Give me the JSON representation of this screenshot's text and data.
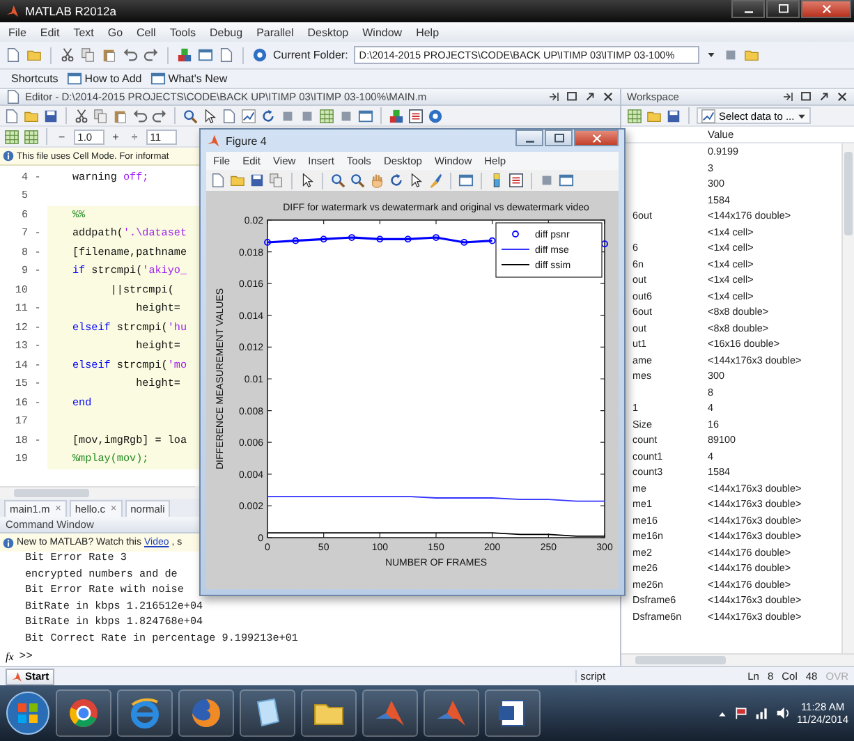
{
  "window": {
    "title": "MATLAB  R2012a"
  },
  "menu": [
    "File",
    "Edit",
    "Text",
    "Go",
    "Cell",
    "Tools",
    "Debug",
    "Parallel",
    "Desktop",
    "Window",
    "Help"
  ],
  "toolbar": {
    "folder_label": "Current Folder:",
    "folder_path": "D:\\2014-2015 PROJECTS\\CODE\\BACK UP\\ITIMP 03\\ITIMP 03-100%"
  },
  "shortcuts": [
    {
      "label": "Shortcuts",
      "kind": "plain"
    },
    {
      "label": "How to Add",
      "kind": "link"
    },
    {
      "label": "What's New",
      "kind": "link"
    }
  ],
  "editor": {
    "title": "Editor - D:\\2014-2015 PROJECTS\\CODE\\BACK UP\\ITIMP 03\\ITIMP 03-100%\\MAIN.m",
    "zoom": {
      "minus": "−",
      "value": "1.0",
      "plus": "+",
      "divide": "÷",
      "cell": "11"
    },
    "info": "This file uses Cell Mode. For informat",
    "lines": [
      {
        "num": "4",
        "marker": "-",
        "in_cell": false,
        "tokens": [
          {
            "kind": "plain",
            "text": "warning "
          },
          {
            "kind": "string",
            "text": "off;"
          }
        ]
      },
      {
        "num": "5",
        "in_cell": false
      },
      {
        "num": "6",
        "in_cell": true,
        "tokens": [
          {
            "kind": "comment",
            "text": "%%"
          }
        ]
      },
      {
        "num": "7",
        "marker": "-",
        "in_cell": true,
        "tokens": [
          {
            "kind": "plain",
            "text": "addpath("
          },
          {
            "kind": "string",
            "text": "'.\\dataset"
          }
        ]
      },
      {
        "num": "8",
        "marker": "-",
        "in_cell": true,
        "tokens": [
          {
            "kind": "plain",
            "text": "[filename,pathname"
          }
        ]
      },
      {
        "num": "9",
        "marker": "-",
        "in_cell": true,
        "tokens": [
          {
            "kind": "keyword",
            "text": "if"
          },
          {
            "kind": "plain",
            "text": " strcmpi("
          },
          {
            "kind": "string",
            "text": "'akiyo_"
          }
        ]
      },
      {
        "num": "10",
        "in_cell": true,
        "tokens": [
          {
            "kind": "plain",
            "text": "      ||strcmpi("
          }
        ]
      },
      {
        "num": "11",
        "marker": "-",
        "in_cell": true,
        "tokens": [
          {
            "kind": "plain",
            "text": "          height="
          }
        ]
      },
      {
        "num": "12",
        "marker": "-",
        "in_cell": true,
        "tokens": [
          {
            "kind": "keyword",
            "text": "elseif"
          },
          {
            "kind": "plain",
            "text": " strcmpi("
          },
          {
            "kind": "string",
            "text": "'hu"
          }
        ]
      },
      {
        "num": "13",
        "marker": "-",
        "in_cell": true,
        "tokens": [
          {
            "kind": "plain",
            "text": "          height="
          }
        ]
      },
      {
        "num": "14",
        "marker": "-",
        "in_cell": true,
        "tokens": [
          {
            "kind": "keyword",
            "text": "elseif"
          },
          {
            "kind": "plain",
            "text": " strcmpi("
          },
          {
            "kind": "string",
            "text": "'mo"
          }
        ]
      },
      {
        "num": "15",
        "marker": "-",
        "in_cell": true,
        "tokens": [
          {
            "kind": "plain",
            "text": "          height="
          }
        ]
      },
      {
        "num": "16",
        "marker": "-",
        "in_cell": true,
        "tokens": [
          {
            "kind": "keyword",
            "text": "end"
          }
        ]
      },
      {
        "num": "17",
        "in_cell": true
      },
      {
        "num": "18",
        "marker": "-",
        "in_cell": true,
        "tokens": [
          {
            "kind": "plain",
            "text": "[mov,imgRgb] = loa"
          }
        ]
      },
      {
        "num": "19",
        "in_cell": true,
        "tokens": [
          {
            "kind": "comment",
            "text": "%mplay(mov);"
          }
        ]
      }
    ],
    "tabs": [
      {
        "label": "main1.m",
        "close": "×"
      },
      {
        "label": "hello.c",
        "close": "×"
      },
      {
        "label": "normali"
      }
    ]
  },
  "command": {
    "title": "Command Window",
    "info": {
      "text": "New to MATLAB? Watch this",
      "link": "Video",
      "tail": ", s"
    },
    "output": [
      "Bit Error Rate 3",
      "encrypted numbers and de",
      "Bit Error Rate with noise",
      "BitRate in kbps 1.216512e+04",
      "BitRate in kbps 1.824768e+04",
      "Bit Correct Rate in percentage 9.199213e+01"
    ],
    "prompt": {
      "fx": "fx",
      "symbol": ">>"
    }
  },
  "workspace": {
    "title": "Workspace",
    "select_button": "Select data to ...",
    "value_header": "Value",
    "rows": [
      {
        "value": "0.9199"
      },
      {
        "value": "3"
      },
      {
        "value": "300"
      },
      {
        "value": "1584"
      },
      {
        "name": "6out",
        "value": "<144x176 double>"
      },
      {
        "value": "<1x4 cell>"
      },
      {
        "name": "6",
        "value": "<1x4 cell>"
      },
      {
        "name": "6n",
        "value": "<1x4 cell>"
      },
      {
        "name": "out",
        "value": "<1x4 cell>"
      },
      {
        "name": "out6",
        "value": "<1x4 cell>"
      },
      {
        "name": "6out",
        "value": "<8x8 double>"
      },
      {
        "name": "out",
        "value": "<8x8 double>"
      },
      {
        "name": "ut1",
        "value": "<16x16 double>"
      },
      {
        "name": "ame",
        "value": "<144x176x3 double>"
      },
      {
        "name": "mes",
        "value": "300"
      },
      {
        "value": "8"
      },
      {
        "name": "1",
        "value": "4"
      },
      {
        "name": "Size",
        "value": "16"
      },
      {
        "name": "count",
        "value": "89100"
      },
      {
        "name": "count1",
        "value": "4"
      },
      {
        "name": "count3",
        "value": "1584"
      },
      {
        "name": "me",
        "value": "<144x176x3 double>"
      },
      {
        "name": "me1",
        "value": "<144x176x3 double>"
      },
      {
        "name": "me16",
        "value": "<144x176x3 double>"
      },
      {
        "name": "me16n",
        "value": "<144x176x3 double>"
      },
      {
        "name": "me2",
        "value": "<144x176 double>"
      },
      {
        "name": "me26",
        "value": "<144x176 double>"
      },
      {
        "name": "me26n",
        "value": "<144x176 double>"
      },
      {
        "name": "Dsframe6",
        "value": "<144x176x3 double>"
      },
      {
        "name": "Dsframe6n",
        "value": "<144x176x3 double>"
      }
    ]
  },
  "figure": {
    "title": "Figure 4",
    "menu": [
      "File",
      "Edit",
      "View",
      "Insert",
      "Tools",
      "Desktop",
      "Window",
      "Help"
    ],
    "chart_data": {
      "type": "line",
      "title": "DIFF for watermark vs dewatermark and original vs dewatermark video",
      "xlabel": "NUMBER OF FRAMES",
      "ylabel": "DIFFERENCE MEASUREMENT VALUES",
      "x": [
        0,
        25,
        50,
        75,
        100,
        125,
        150,
        175,
        200,
        225,
        250,
        275,
        300
      ],
      "legend": true,
      "series": [
        {
          "name": "diff psnr",
          "color": "#0000ff",
          "marker": "o",
          "values": [
            0.0186,
            0.0187,
            0.0188,
            0.0189,
            0.0188,
            0.0188,
            0.0189,
            0.0186,
            0.0187,
            null,
            null,
            null,
            0.0185
          ]
        },
        {
          "name": "diff mse",
          "color": "#3333ff",
          "values": [
            0.0026,
            0.0026,
            0.0026,
            0.0026,
            0.0026,
            0.0026,
            0.0025,
            0.0025,
            0.0025,
            0.0024,
            0.0024,
            0.0023,
            0.0023
          ]
        },
        {
          "name": "diff ssim",
          "color": "#000000",
          "values": [
            0.0003,
            0.0003,
            0.0003,
            0.0003,
            0.0003,
            0.0003,
            0.0003,
            0.0003,
            0.0003,
            0.0002,
            0.0002,
            0.0001,
            0.0001
          ]
        }
      ],
      "xlim": [
        0,
        300
      ],
      "ylim": [
        0,
        0.02
      ],
      "xticks": [
        0,
        50,
        100,
        150,
        200,
        250,
        300
      ],
      "yticks": [
        0,
        0.002,
        0.004,
        0.006,
        0.008,
        0.01,
        0.012,
        0.014,
        0.016,
        0.018,
        0.02
      ]
    }
  },
  "status": {
    "start": "Start",
    "mode": "script",
    "ln_label": "Ln",
    "ln": "8",
    "col_label": "Col",
    "col": "48",
    "ovr": "OVR",
    "ovr_disabled": true
  },
  "taskbar": {
    "time": "11:28 AM",
    "date": "11/24/2014"
  }
}
